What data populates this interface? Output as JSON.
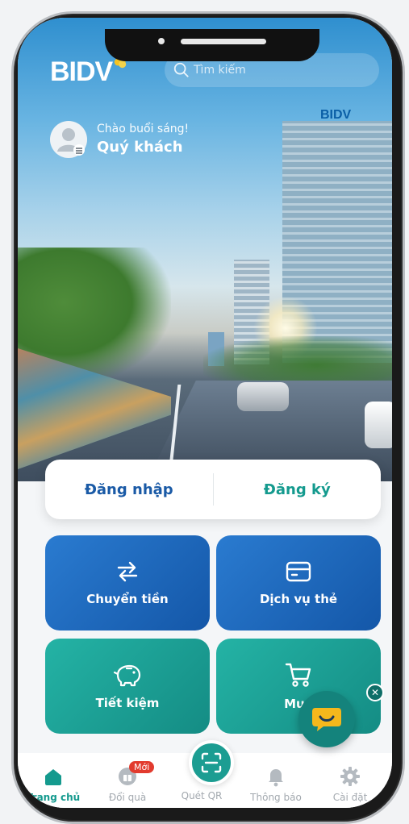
{
  "app": {
    "logo": "BIDV"
  },
  "search": {
    "placeholder": "Tìm kiếm"
  },
  "hero": {
    "building_sign": "BIDV"
  },
  "user": {
    "greeting": "Chào buổi sáng!",
    "name": "Quý khách"
  },
  "auth": {
    "login_label": "Đăng nhập",
    "register_label": "Đăng ký"
  },
  "tiles": [
    {
      "label": "Chuyển tiền",
      "icon": "transfer-icon",
      "color": "#1f6cc0"
    },
    {
      "label": "Dịch vụ thẻ",
      "icon": "card-icon",
      "color": "#1f6cc0"
    },
    {
      "label": "Tiết kiệm",
      "icon": "piggy-bank-icon",
      "color": "#1aa397"
    },
    {
      "label": "Mua ",
      "icon": "cart-icon",
      "color": "#1aa397"
    }
  ],
  "tabbar": {
    "items": [
      {
        "label": "Trang chủ",
        "icon": "home-icon",
        "active": true
      },
      {
        "label": "Đổi quà",
        "icon": "gift-icon",
        "badge": "Mới"
      },
      {
        "label": "Quét QR",
        "icon": "qr-scan-icon"
      },
      {
        "label": "Thông báo",
        "icon": "bell-icon"
      },
      {
        "label": "Cài đặt",
        "icon": "gear-icon"
      }
    ]
  },
  "colors": {
    "primary_blue": "#1a5aa6",
    "teal": "#149a8e",
    "badge_red": "#e23b2e"
  }
}
